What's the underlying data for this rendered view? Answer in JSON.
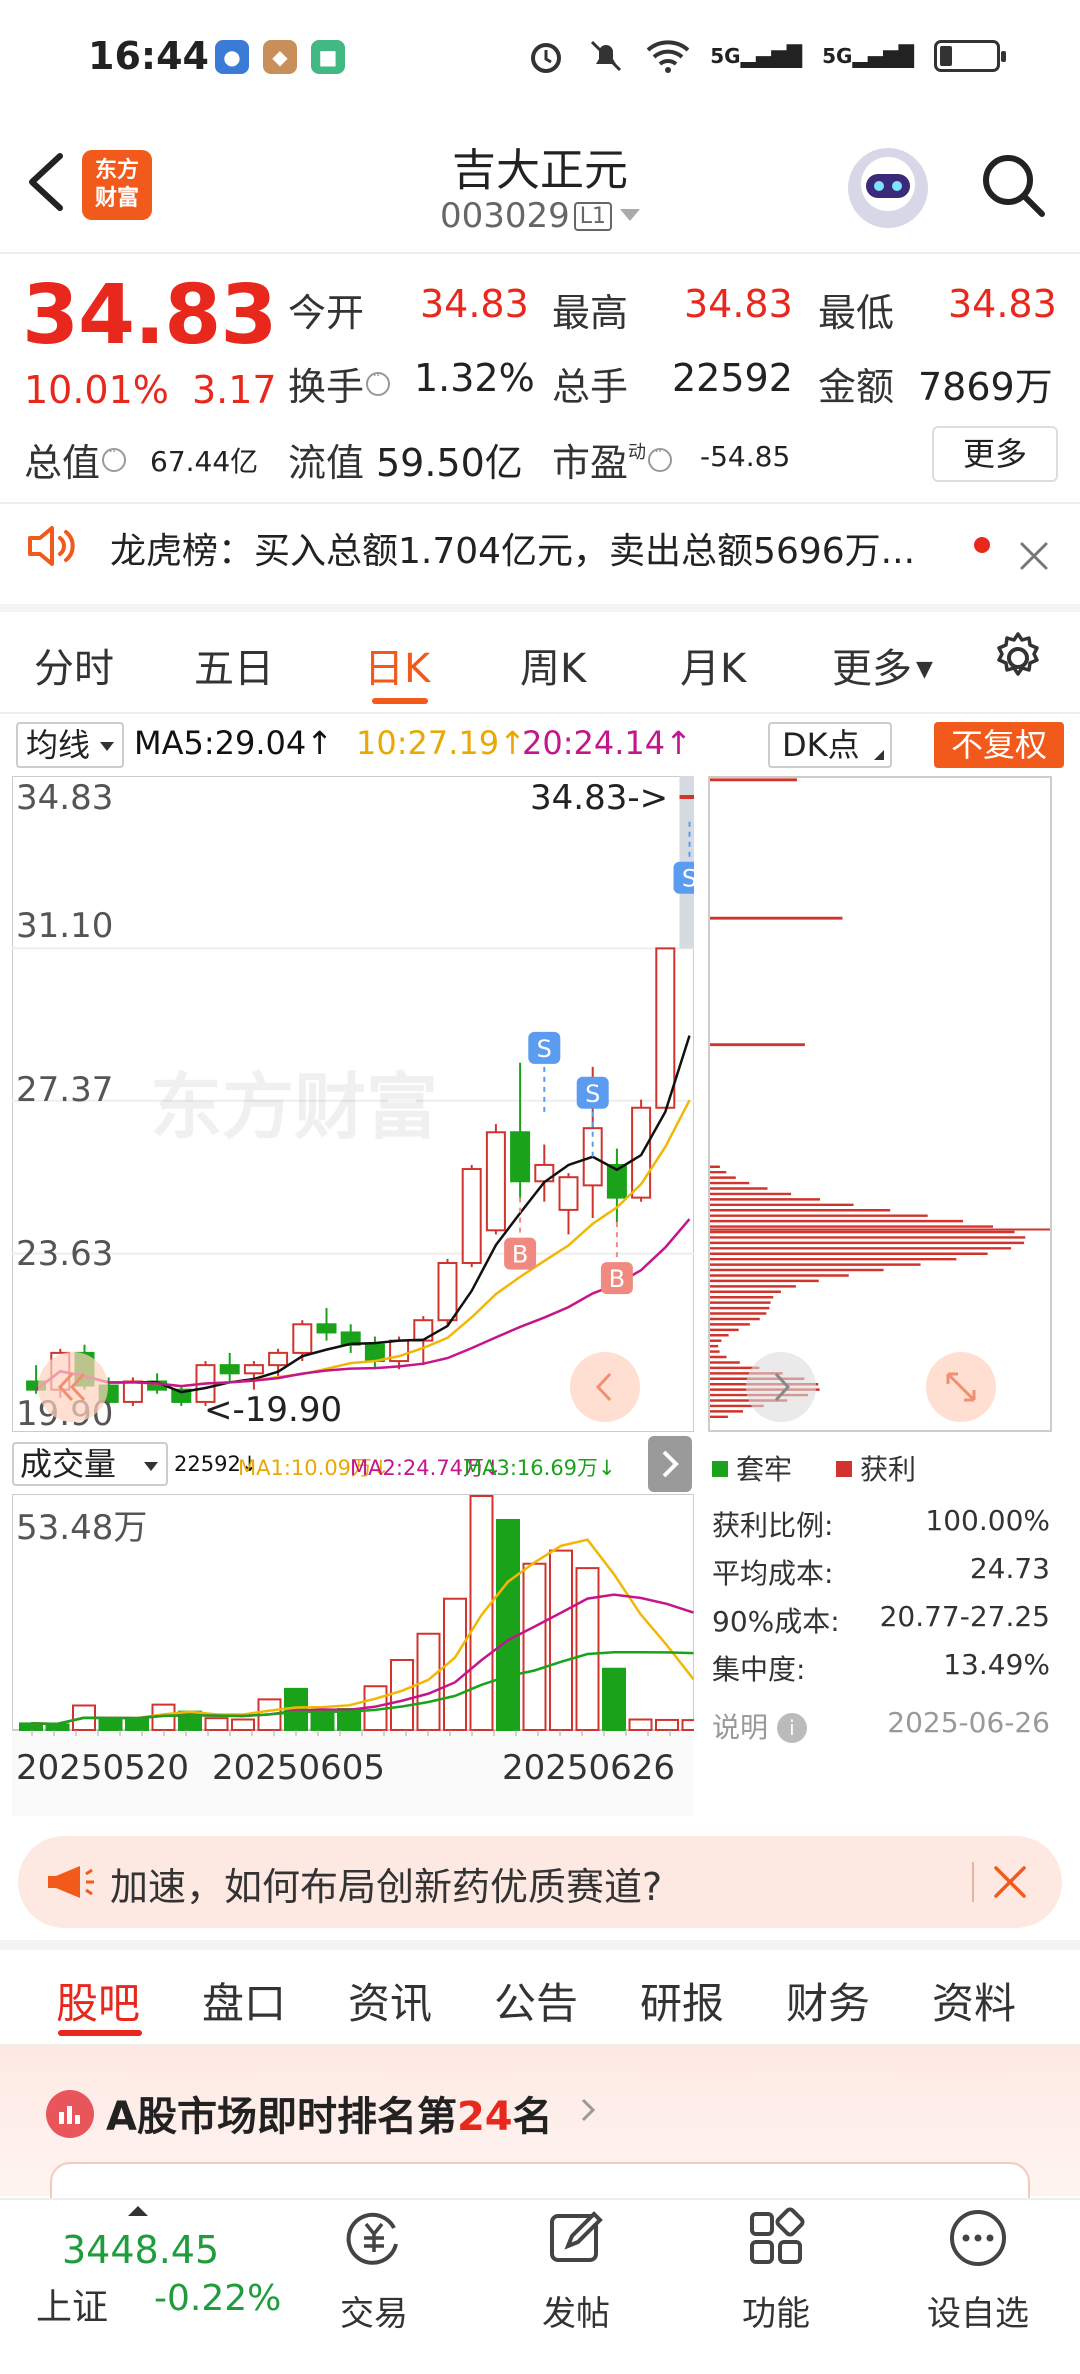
{
  "status_bar": {
    "time": "16:44",
    "signal1": "5G",
    "signal2": "5G"
  },
  "header": {
    "logo_text": "东方财富",
    "stock_name": "吉大正元",
    "stock_code": "003029",
    "level_badge": "L1"
  },
  "quote": {
    "price": "34.83",
    "change_pct": "10.01%",
    "change_val": "3.17",
    "open_label": "今开",
    "open_val": "34.83",
    "high_label": "最高",
    "high_val": "34.83",
    "low_label": "最低",
    "low_val": "34.83",
    "turnover_label": "换手",
    "turnover_val": "1.32%",
    "volume_label": "总手",
    "volume_val": "22592",
    "amount_label": "金额",
    "amount_val": "7869万",
    "mktcap_label": "总值",
    "mktcap_val": "67.44亿",
    "float_label": "流值",
    "float_val": "59.50亿",
    "pe_label": "市盈",
    "pe_sup": "动",
    "pe_val": "-54.85",
    "more_label": "更多"
  },
  "news": {
    "text": "龙虎榜：买入总额1.704亿元，卖出总额5696万..."
  },
  "chart_tabs": [
    "分时",
    "五日",
    "日K",
    "周K",
    "月K",
    "更多"
  ],
  "ma_row": {
    "select": "均线",
    "ma5": "MA5:29.04↑",
    "ma10": "10:27.19↑",
    "ma20": "20:24.14↑",
    "dk": "DK点",
    "fq": "不复权"
  },
  "kline": {
    "y_labels": [
      "34.83",
      "31.10",
      "27.37",
      "23.63",
      "19.90"
    ],
    "max_label": "34.83->",
    "min_label": "<-19.90",
    "watermark": "东方财富",
    "b_marker": "B",
    "s_marker": "S",
    "colors": {
      "up": "#d0342c",
      "down": "#1aa31a",
      "ma5": "#111111",
      "ma10": "#f2b705",
      "ma20": "#c4168c"
    }
  },
  "chart_data": [
    {
      "type": "candlestick",
      "title": "",
      "ylim": [
        19.9,
        34.83
      ],
      "ma": {
        "MA5": 29.04,
        "MA10": 27.19,
        "MA20": 24.14
      },
      "candles_ohlc": [
        [
          20.5,
          20.9,
          20.2,
          20.3
        ],
        [
          20.3,
          21.3,
          20.1,
          21.2
        ],
        [
          21.2,
          21.4,
          20.3,
          20.4
        ],
        [
          20.4,
          20.6,
          19.9,
          20.0
        ],
        [
          20.0,
          20.6,
          19.9,
          20.5
        ],
        [
          20.5,
          20.7,
          20.2,
          20.3
        ],
        [
          20.3,
          20.4,
          19.9,
          20.0
        ],
        [
          20.0,
          21.0,
          19.9,
          20.9
        ],
        [
          20.9,
          21.2,
          20.5,
          20.7
        ],
        [
          20.7,
          21.0,
          20.3,
          20.9
        ],
        [
          20.9,
          21.3,
          20.6,
          21.2
        ],
        [
          21.2,
          22.0,
          21.0,
          21.9
        ],
        [
          21.9,
          22.3,
          21.5,
          21.7
        ],
        [
          21.7,
          21.9,
          21.2,
          21.4
        ],
        [
          21.4,
          21.6,
          20.8,
          21.0
        ],
        [
          21.0,
          21.6,
          20.8,
          21.5
        ],
        [
          21.5,
          22.1,
          20.9,
          22.0
        ],
        [
          22.0,
          23.5,
          21.9,
          23.4
        ],
        [
          23.4,
          25.8,
          23.3,
          25.7
        ],
        [
          24.2,
          26.8,
          24.1,
          26.6
        ],
        [
          26.6,
          28.3,
          25.0,
          25.4
        ],
        [
          25.4,
          26.3,
          24.9,
          25.8
        ],
        [
          24.7,
          25.6,
          24.1,
          25.5
        ],
        [
          25.3,
          28.2,
          24.5,
          26.7
        ],
        [
          25.8,
          26.2,
          24.4,
          25.0
        ],
        [
          25.0,
          27.4,
          24.9,
          27.2
        ],
        [
          27.2,
          31.1,
          27.2,
          31.1
        ],
        [
          34.83,
          34.83,
          34.83,
          34.83
        ]
      ],
      "buy_markers": [
        "day 21",
        "day 24"
      ],
      "sell_markers": [
        "day 22",
        "day 24"
      ]
    },
    {
      "type": "bar",
      "title": "成交量",
      "ylabel": "53.48万",
      "x_ticks": [
        "20250520",
        "20250605",
        "20250626"
      ],
      "volumes_wan": [
        1.5,
        1.3,
        5.6,
        2.6,
        2.6,
        5.8,
        4.2,
        2.7,
        2.4,
        7.0,
        9.4,
        4.6,
        4.8,
        10.0,
        16.0,
        22.0,
        30.0,
        53.48,
        48.0,
        38.0,
        41.0,
        37.0,
        14.0,
        2.4,
        2.3,
        2.26
      ],
      "ma_text": {
        "vol": "22592↓",
        "ma1": "MA1:10.09万↓",
        "ma2": "MA2:24.74万↓",
        "ma3": "MA3:16.69万↓"
      }
    }
  ],
  "chip": {
    "legend_trapped": "套牢",
    "legend_profit": "获利",
    "profit_ratio_label": "获利比例:",
    "profit_ratio": "100.00%",
    "avg_cost_label": "平均成本:",
    "avg_cost": "24.73",
    "cost90_label": "90%成本:",
    "cost90": "20.77-27.25",
    "concentration_label": "集中度:",
    "concentration": "13.49%",
    "note_label": "说明",
    "date": "2025-06-26"
  },
  "volume": {
    "select": "成交量",
    "vol": "22592↓",
    "ma1": "MA1:10.09万↓",
    "ma2": "MA2:24.74万↓",
    "ma3": "MA3:16.69万↓",
    "max_label": "53.48万",
    "dates": [
      "20250520",
      "20250605",
      "20250626"
    ]
  },
  "promo": {
    "text": "加速，如何布局创新药优质赛道?"
  },
  "bottom_tabs": [
    "股吧",
    "盘口",
    "资讯",
    "公告",
    "研报",
    "财务",
    "资料"
  ],
  "rank": {
    "prefix": "A股市场即时排名第",
    "num": "24",
    "suffix": "名"
  },
  "bottom_bar": {
    "index_val": "3448.45",
    "index_name": "上证",
    "index_chg": "-0.22%",
    "nav": [
      "交易",
      "发帖",
      "功能",
      "设自选"
    ]
  }
}
